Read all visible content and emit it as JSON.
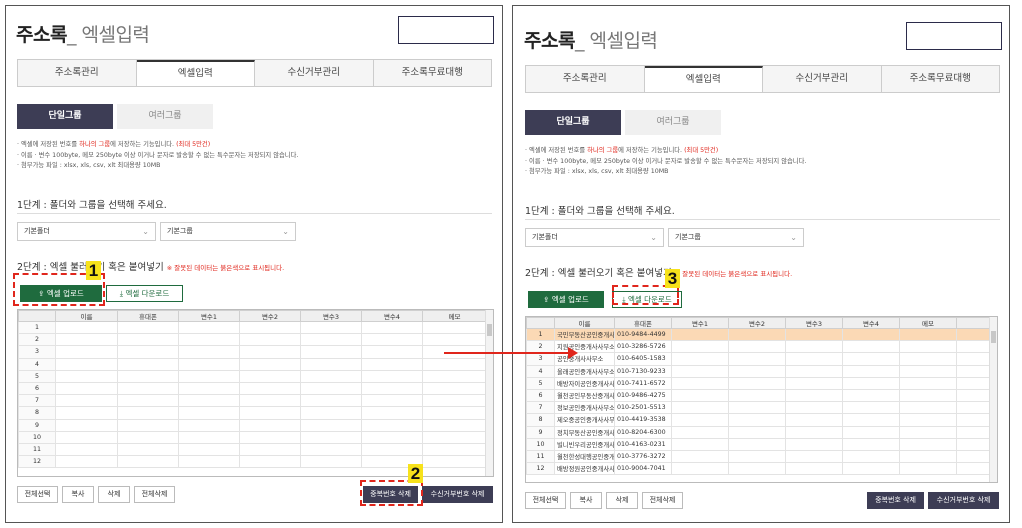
{
  "title": {
    "main": "주소록",
    "sub": "_ 엑셀입력"
  },
  "tabs": [
    "주소록관리",
    "엑셀입력",
    "수신거부관리",
    "주소록무료대행"
  ],
  "group_buttons": {
    "single": "단일그룹",
    "multi": "여러그룹"
  },
  "notes": {
    "line1_pre": "· 엑셀에 저장된 번호를 ",
    "line1_hl": "하나의 그룹",
    "line1_mid": "에 저장하는 기능입니다. ",
    "line1_max": "(최대 5만건)",
    "line2": "· 이름 · 변수 100byte, 메모 250byte 이상 이거나 문자로 발송할 수 없는 특수문자는 저장되지 않습니다.",
    "line3": "· 첨부가능 파일 : xlsx, xls, csv, xlt 최대용량 10MB"
  },
  "step1": "1단계 : 폴더와 그룹을 선택해 주세요.",
  "select_folder": "기본폴더",
  "select_group": "기본그룹",
  "step2": "2단계 : 엑셀 불러오기 혹은 붙여넣기",
  "step2_warn": "※ 잘못된 데이터는 붉은색으로 표시됩니다.",
  "upload_label": "엑셀 업로드",
  "download_label": "엑셀 다운로드",
  "icons": {
    "upload": "upload-icon",
    "download": "download-icon"
  },
  "grid_headers": [
    "이름",
    "휴대폰",
    "변수1",
    "변수2",
    "변수3",
    "변수4",
    "메모"
  ],
  "row_numbers": [
    "1",
    "2",
    "3",
    "4",
    "5",
    "6",
    "7",
    "8",
    "9",
    "10",
    "11",
    "12"
  ],
  "filled_rows": [
    {
      "name": "국민부동산공인중개사...",
      "phone": "010-9484-4499"
    },
    {
      "name": "지원공인중개사사무소",
      "phone": "010-3286-5726"
    },
    {
      "name": "공인중개사사무소",
      "phone": "010-6405-1583"
    },
    {
      "name": "올래공인중개사사무소",
      "phone": "010-7130-9233"
    },
    {
      "name": "배방자이공인중개사사...",
      "phone": "010-7411-6572"
    },
    {
      "name": "월천공인부동산중개사...",
      "phone": "010-9486-4275"
    },
    {
      "name": "정보공인중개사사무소",
      "phone": "010-2501-5513"
    },
    {
      "name": "제오중공인중개사사무소",
      "phone": "010-4419-3538"
    },
    {
      "name": "정치부동산공인중개사...",
      "phone": "010-8204-6300"
    },
    {
      "name": "빌니빈우리공인중개사...",
      "phone": "010-4163-0231"
    },
    {
      "name": "월천한성대행공인중개...",
      "phone": "010-3776-3272"
    },
    {
      "name": "배방정원공인중개사사...",
      "phone": "010-9004-7041"
    }
  ],
  "bottom_buttons": {
    "select_all": "전체선택",
    "copy": "복사",
    "delete": "삭제",
    "delete_all": "전체삭제"
  },
  "dup_delete": "중복번호 삭제",
  "reject_delete": "수신거부번호 삭제",
  "badges": [
    "1",
    "2",
    "3"
  ],
  "colors": {
    "accent_dark": "#3d3d55",
    "excel_green": "#1f6b3e",
    "callout_red": "#e0261c",
    "badge_yellow": "#f7e21b",
    "highlight_row": "#fbd9b5"
  }
}
